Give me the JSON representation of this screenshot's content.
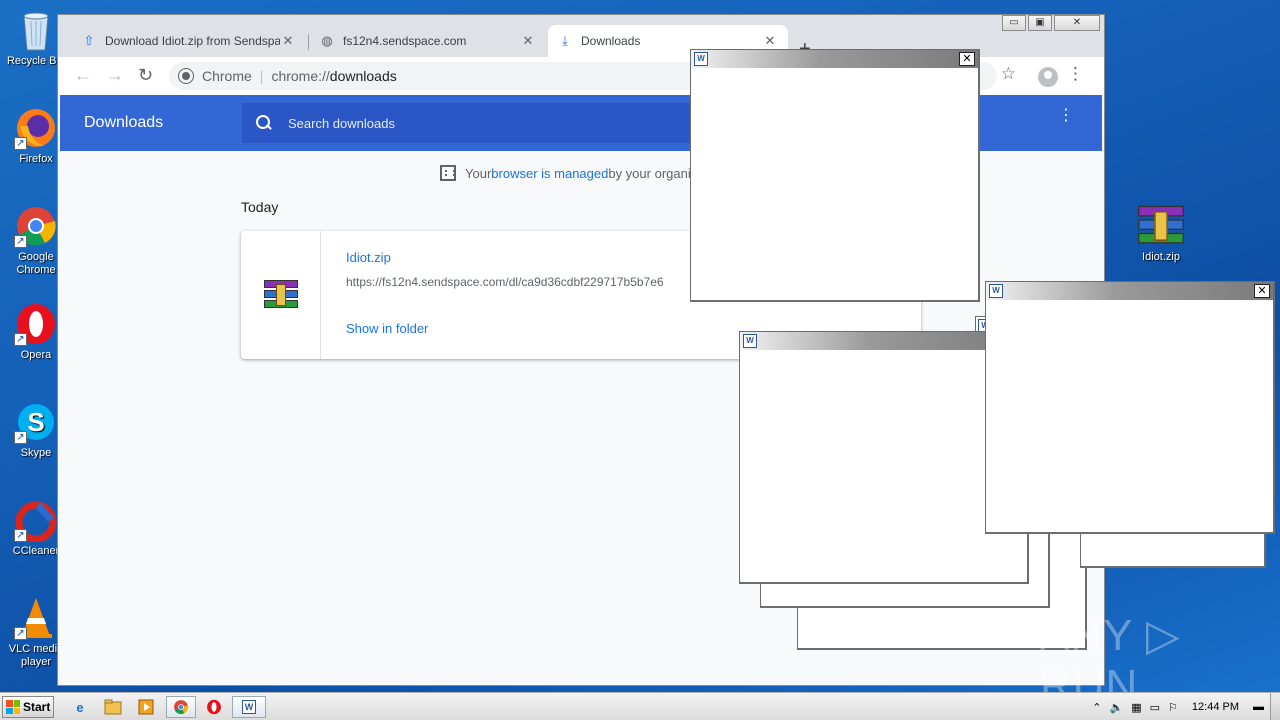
{
  "desktop": {
    "icons": [
      {
        "label": "Recycle Bin",
        "icon": "recycle-bin-icon"
      },
      {
        "label": "Firefox",
        "icon": "firefox-icon"
      },
      {
        "label": "Google Chrome",
        "icon": "chrome-icon"
      },
      {
        "label": "Opera",
        "icon": "opera-icon"
      },
      {
        "label": "Skype",
        "icon": "skype-icon"
      },
      {
        "label": "CCleaner",
        "icon": "ccleaner-icon"
      },
      {
        "label": "VLC media player",
        "icon": "vlc-icon"
      },
      {
        "label": "Idiot.zip",
        "icon": "winrar-archive-icon"
      }
    ]
  },
  "browser": {
    "tabs": [
      {
        "title": "Download Idiot.zip from Sendspace.c",
        "icon": "upload-arrow-icon",
        "close": "✕"
      },
      {
        "title": "fs12n4.sendspace.com",
        "icon": "globe-icon",
        "close": "✕"
      },
      {
        "title": "Downloads",
        "icon": "download-icon",
        "close": "✕"
      }
    ],
    "new_tab": "+",
    "window_controls": {
      "minimize": "▭",
      "maximize": "▣",
      "close": "✕"
    },
    "omnibox": {
      "label": "Chrome",
      "separator": "|",
      "scheme": "chrome://",
      "path": "downloads"
    },
    "nav": {
      "back": "←",
      "forward": "→",
      "reload": "↻",
      "star": "☆",
      "menu": "⋮"
    }
  },
  "downloads_page": {
    "title": "Downloads",
    "search_placeholder": "Search downloads",
    "menu": "⋮",
    "managed_notice": {
      "prefix": "Your ",
      "link": "browser is managed",
      "suffix": " by your organi"
    },
    "section": "Today",
    "items": [
      {
        "name": "Idiot.zip",
        "url": "https://fs12n4.sendspace.com/dl/ca9d36cdbf229717b5b7e6",
        "action": "Show in folder"
      }
    ]
  },
  "popups": [
    {
      "icon": "word-document-icon",
      "close": "✕"
    },
    {
      "icon": "word-document-icon",
      "close": "✕"
    },
    {
      "icon": "word-document-icon",
      "close": ""
    }
  ],
  "taskbar": {
    "start_label": "Start",
    "apps": [
      "ie-icon",
      "explorer-icon",
      "media-player-icon",
      "chrome-icon",
      "opera-icon",
      "word-icon"
    ],
    "clock": "12:44 PM",
    "tray_arrow": "⌃"
  },
  "watermark": "ANY ▷ RUN"
}
